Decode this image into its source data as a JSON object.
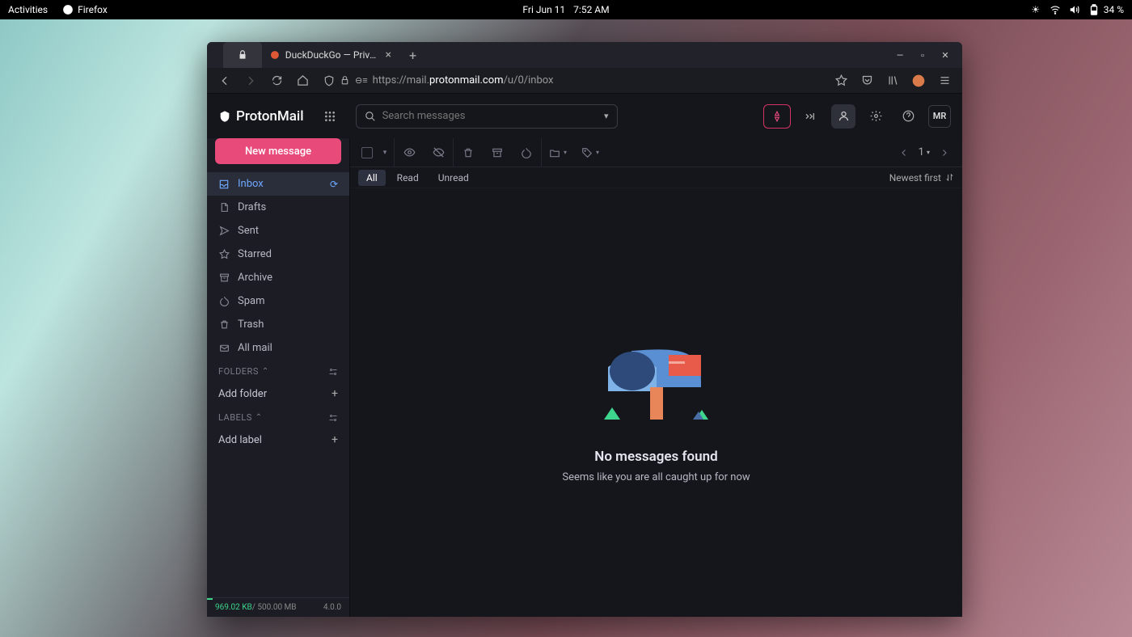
{
  "topbar": {
    "activities": "Activities",
    "app_name": "Firefox",
    "date": "Fri Jun 11",
    "time": "7:52 AM",
    "battery": "34 %"
  },
  "browser": {
    "tabs": {
      "active_title": "DuckDuckGo — Privacy, s"
    },
    "url": {
      "prefix": "https://mail.",
      "domain": "protonmail.com",
      "path": "/u/0/inbox"
    }
  },
  "app": {
    "brand": "ProtonMail",
    "search_placeholder": "Search messages",
    "compose": "New message",
    "folders": [
      {
        "label": "Inbox",
        "icon": "inbox",
        "active": true,
        "refresh": true
      },
      {
        "label": "Drafts",
        "icon": "drafts"
      },
      {
        "label": "Sent",
        "icon": "sent"
      },
      {
        "label": "Starred",
        "icon": "star"
      },
      {
        "label": "Archive",
        "icon": "archive"
      },
      {
        "label": "Spam",
        "icon": "spam"
      },
      {
        "label": "Trash",
        "icon": "trash"
      },
      {
        "label": "All mail",
        "icon": "allmail"
      }
    ],
    "sections": {
      "folders": "FOLDERS",
      "add_folder": "Add folder",
      "labels": "LABELS",
      "add_label": "Add label"
    },
    "storage": {
      "used": "969.02 KB",
      "total": " / 500.00 MB",
      "version": "4.0.0"
    },
    "pager": {
      "current": "1"
    },
    "filters": {
      "all": "All",
      "read": "Read",
      "unread": "Unread"
    },
    "sort": "Newest first",
    "empty": {
      "title": "No messages found",
      "subtitle": "Seems like you are all caught up for now"
    },
    "avatar": "MR"
  }
}
